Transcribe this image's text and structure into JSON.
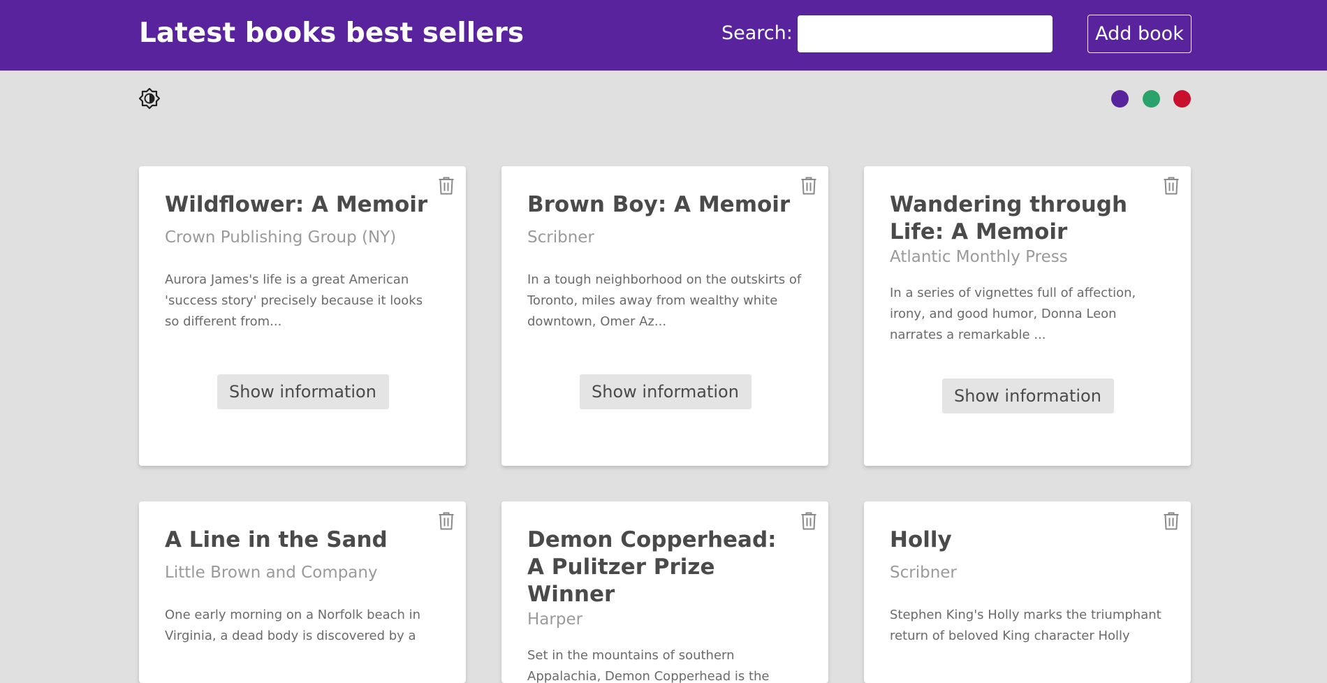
{
  "header": {
    "title": "Latest books best sellers",
    "search_label": "Search:",
    "search_value": "",
    "add_book_label": "Add book",
    "background": "#58239d"
  },
  "toolbar": {
    "theme_toggle_icon": "brightness-contrast-icon",
    "color_swatches": [
      {
        "name": "purple",
        "color": "#58239d"
      },
      {
        "name": "green",
        "color": "#2aa36b"
      },
      {
        "name": "red",
        "color": "#c8102e"
      }
    ]
  },
  "books": [
    {
      "title": "Wildflower: A Memoir",
      "publisher": "Crown Publishing Group (NY)",
      "description": "Aurora James's life is a great American 'success story' precisely because it looks so different from...",
      "button_label": "Show information"
    },
    {
      "title": "Brown Boy: A Memoir",
      "publisher": "Scribner",
      "description": "In a tough neighborhood on the outskirts of Toronto, miles away from wealthy white downtown, Omer Az...",
      "button_label": "Show information"
    },
    {
      "title": "Wandering through Life: A Memoir",
      "publisher": "Atlantic Monthly Press",
      "description": "In a series of vignettes full of affection, irony, and good humor, Donna Leon narrates a remarkable ...",
      "button_label": "Show information"
    },
    {
      "title": "A Line in the Sand",
      "publisher": "Little Brown and Company",
      "description": "One early morning on a Norfolk beach in Virginia, a dead body is discovered by a",
      "button_label": "Show information"
    },
    {
      "title": "Demon Copperhead: A Pulitzer Prize Winner",
      "publisher": "Harper",
      "description": "Set in the mountains of southern Appalachia, Demon Copperhead is the",
      "button_label": "Show information"
    },
    {
      "title": "Holly",
      "publisher": "Scribner",
      "description": "Stephen King's Holly marks the triumphant return of beloved King character Holly",
      "button_label": "Show information"
    }
  ]
}
